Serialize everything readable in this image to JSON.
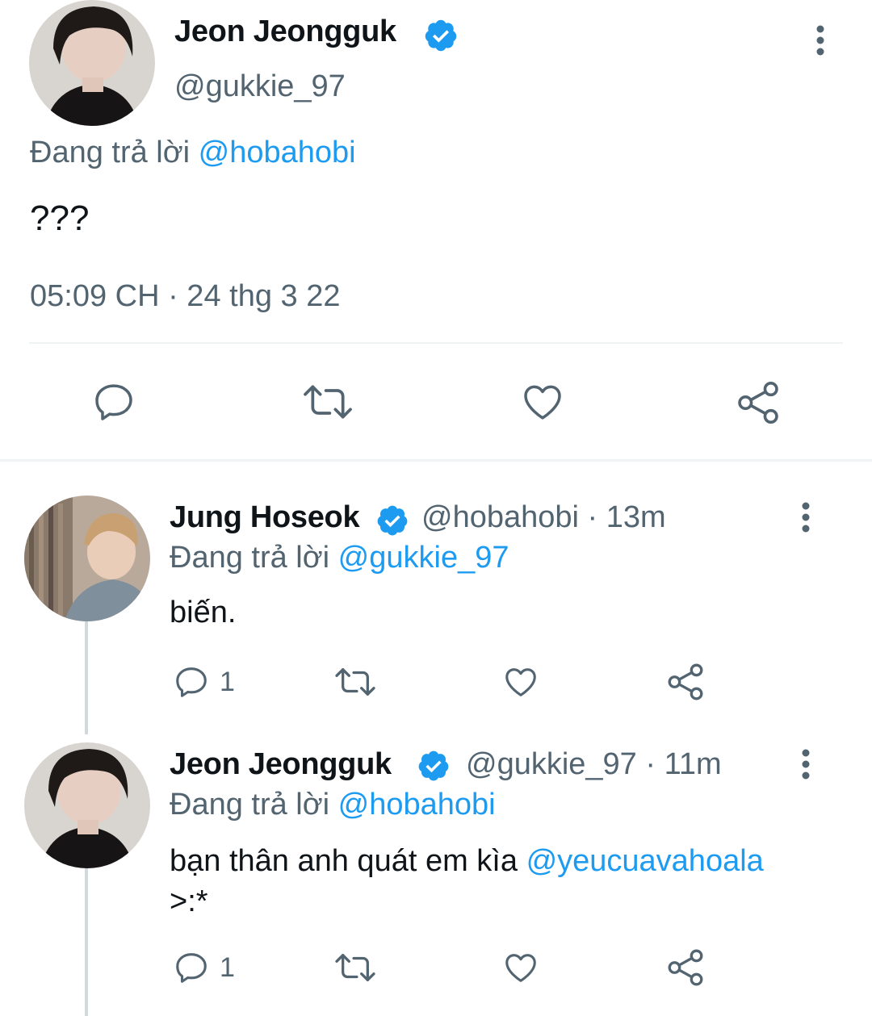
{
  "main_tweet": {
    "name": "Jeon Jeongguk",
    "handle": "@gukkie_97",
    "replying_prefix": "Đang trả lời",
    "replying_to": "@hobahobi",
    "text": "???",
    "timestamp": "05:09 CH · 24 thg 3 22",
    "avatar_icon": "avatar-jeongguk"
  },
  "replies": [
    {
      "name": "Jung Hoseok",
      "handle": "@hobahobi",
      "time": "· 13m",
      "replying_prefix": "Đang trả lời",
      "replying_to": "@gukkie_97",
      "text": "biến.",
      "reply_count": "1",
      "avatar_icon": "avatar-hoseok"
    },
    {
      "name": "Jeon Jeongguk",
      "handle": "@gukkie_97",
      "time": "· 11m",
      "replying_prefix": "Đang trả lời",
      "replying_to": "@hobahobi",
      "text": "bạn thân anh quát em kìa",
      "mention": "@yeucuavahoala",
      "text_tail": ">:*",
      "reply_count": "1",
      "avatar_icon": "avatar-jeongguk"
    }
  ],
  "colors": {
    "accent": "#1d9bf0",
    "text": "#0f1419",
    "secondary": "#536471",
    "divider": "#eff3f4"
  }
}
